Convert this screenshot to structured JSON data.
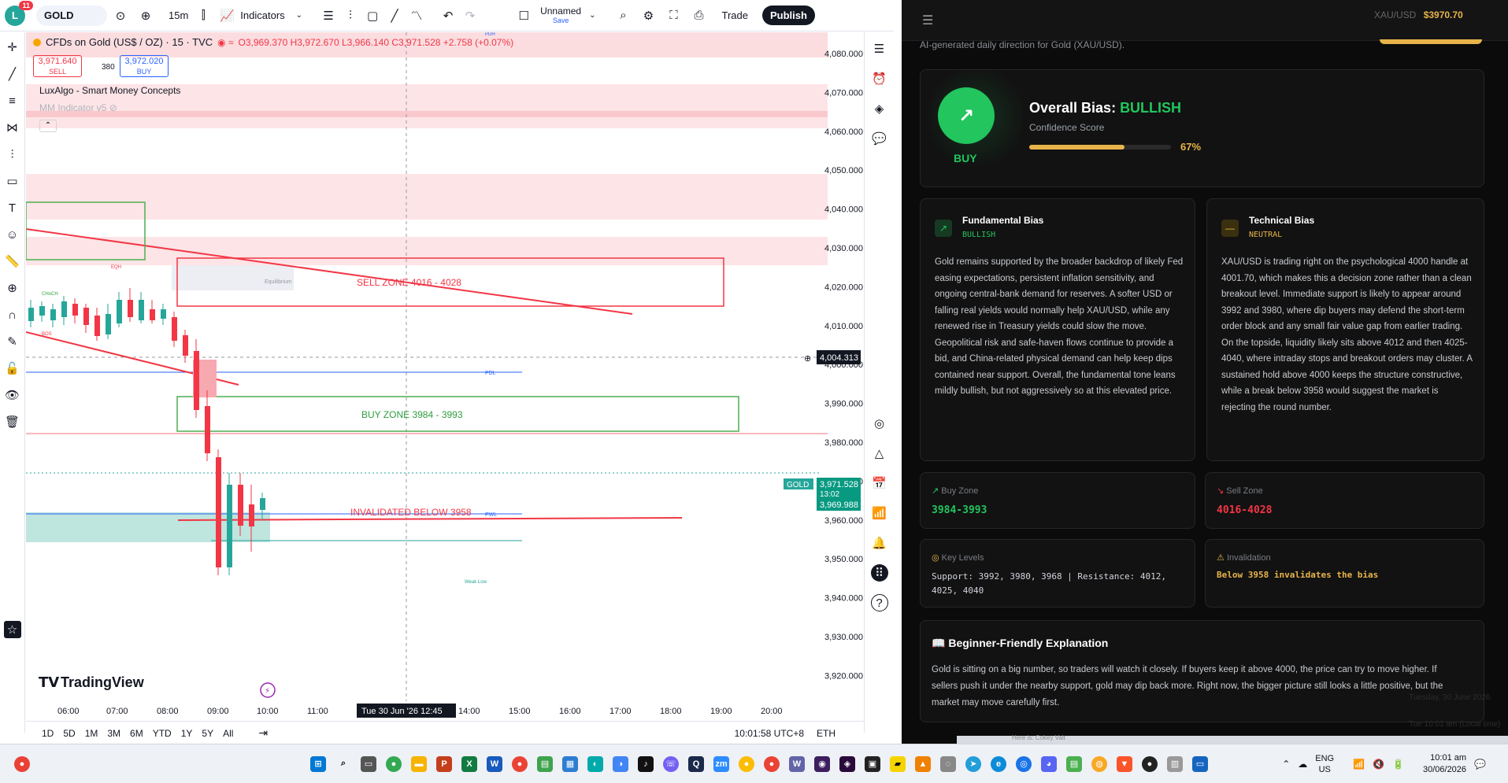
{
  "toolbar": {
    "avatar_letter": "L",
    "notif_count": "11",
    "symbol": "GOLD",
    "interval": "15m",
    "indicators_label": "Indicators",
    "layout_name": "Unnamed",
    "layout_sub": "Save",
    "trade_label": "Trade",
    "publish_label": "Publish"
  },
  "legend": {
    "title": "CFDs on Gold (US$ / OZ) · 15 · TVC",
    "ohlc": "O3,969.370 H3,972.670 L3,966.140 C3,971.528 +2.758 (+0.07%)",
    "sell_price": "3,971.640",
    "sell_label": "SELL",
    "spread": "380",
    "buy_price": "3,972.020",
    "buy_label": "BUY",
    "indicator1": "LuxAlgo - Smart Money Concepts",
    "indicator2": "MM Indicator v5"
  },
  "zones": {
    "sell": "SELL ZONE 4016 - 4028",
    "buy": "BUY ZONE 3984 - 3993",
    "invalid": "INVALIDATED BELOW 3958",
    "eqh": "EQH",
    "choch": "CHoCH",
    "bos": "BOS",
    "equilibrium": "Equilibrium",
    "pdl": "PDL",
    "pwl": "PWL",
    "weak_low": "Weak Low",
    "pdh": "PDH"
  },
  "price_axis": {
    "ticks": [
      "4,080.000",
      "4,070.000",
      "4,060.000",
      "4,050.000",
      "4,040.000",
      "4,030.000",
      "4,020.000",
      "4,010.000",
      "4,000.000",
      "3,990.000",
      "3,980.000",
      "3,970.000",
      "3,960.000",
      "3,950.000",
      "3,940.000",
      "3,930.000",
      "3,920.000"
    ],
    "crosshair": "4,004.313",
    "symbol_tag": "GOLD",
    "last_price": "3,971.528",
    "countdown": "13:02",
    "bid": "3,969.988"
  },
  "time_axis": {
    "ticks": [
      "06:00",
      "07:00",
      "08:00",
      "09:00",
      "10:00",
      "11:00",
      "14:00",
      "15:00",
      "16:00",
      "17:00",
      "18:00",
      "19:00",
      "20:00"
    ],
    "crosshair_label": "Tue 30 Jun '26   12:45"
  },
  "brand": "TradingView",
  "bottom": {
    "ranges": [
      "1D",
      "5D",
      "1M",
      "3M",
      "6M",
      "YTD",
      "1Y",
      "5Y",
      "All"
    ],
    "clock": "10:01:58 UTC+8",
    "session": "ETH"
  },
  "panel": {
    "header_pair": "XAU/USD",
    "header_price": "$3970.70",
    "subtitle": "AI-generated daily direction for Gold (XAU/USD).",
    "bias_prefix": "Overall Bias: ",
    "bias_value": "BULLISH",
    "confidence_label": "Confidence Score",
    "confidence_pct": "67%",
    "confidence": 0.67,
    "badge": "BUY",
    "fundamental": {
      "title": "Fundamental Bias",
      "tag": "BULLISH",
      "text": "Gold remains supported by the broader backdrop of likely Fed easing expectations, persistent inflation sensitivity, and ongoing central-bank demand for reserves. A softer USD or falling real yields would normally help XAU/USD, while any renewed rise in Treasury yields could slow the move. Geopolitical risk and safe-haven flows continue to provide a bid, and China-related physical demand can help keep dips contained near support. Overall, the fundamental tone leans mildly bullish, but not aggressively so at this elevated price."
    },
    "technical": {
      "title": "Technical Bias",
      "tag": "NEUTRAL",
      "text": "XAU/USD is trading right on the psychological 4000 handle at 4001.70, which makes this a decision zone rather than a clean breakout level. Immediate support is likely to appear around 3992 and 3980, where dip buyers may defend the short-term order block and any small fair value gap from earlier trading. On the topside, liquidity likely sits above 4012 and then 4025-4040, where intraday stops and breakout orders may cluster. A sustained hold above 4000 keeps the structure constructive, while a break below 3958 would suggest the market is rejecting the round number."
    },
    "buy_zone": {
      "label": "Buy Zone",
      "value": "3984-3993"
    },
    "sell_zone": {
      "label": "Sell Zone",
      "value": "4016-4028"
    },
    "key_levels": {
      "label": "Key Levels",
      "value": "Support: 3992, 3980, 3968 | Resistance: 4012, 4025, 4040"
    },
    "invalidation": {
      "label": "Invalidation",
      "value": "Below 3958 invalidates the bias"
    },
    "explain": {
      "title": "Beginner-Friendly Explanation",
      "text": "Gold is sitting on a big number, so traders will watch it closely. If buyers keep it above 4000, the price can try to move higher. If sellers push it under the nearby support, gold may dip back more. Right now, the bigger picture still looks a little positive, but the market may move carefully first."
    },
    "ghost_date": "Tuesday, 30 June 2026",
    "ghost_time": "Tue 10:01 am (Local time)",
    "behind_text": "Here is: Cokey Valt"
  },
  "taskbar": {
    "lang": "ENG",
    "region": "US",
    "time": "10:01 am",
    "date": "30/06/2026"
  }
}
